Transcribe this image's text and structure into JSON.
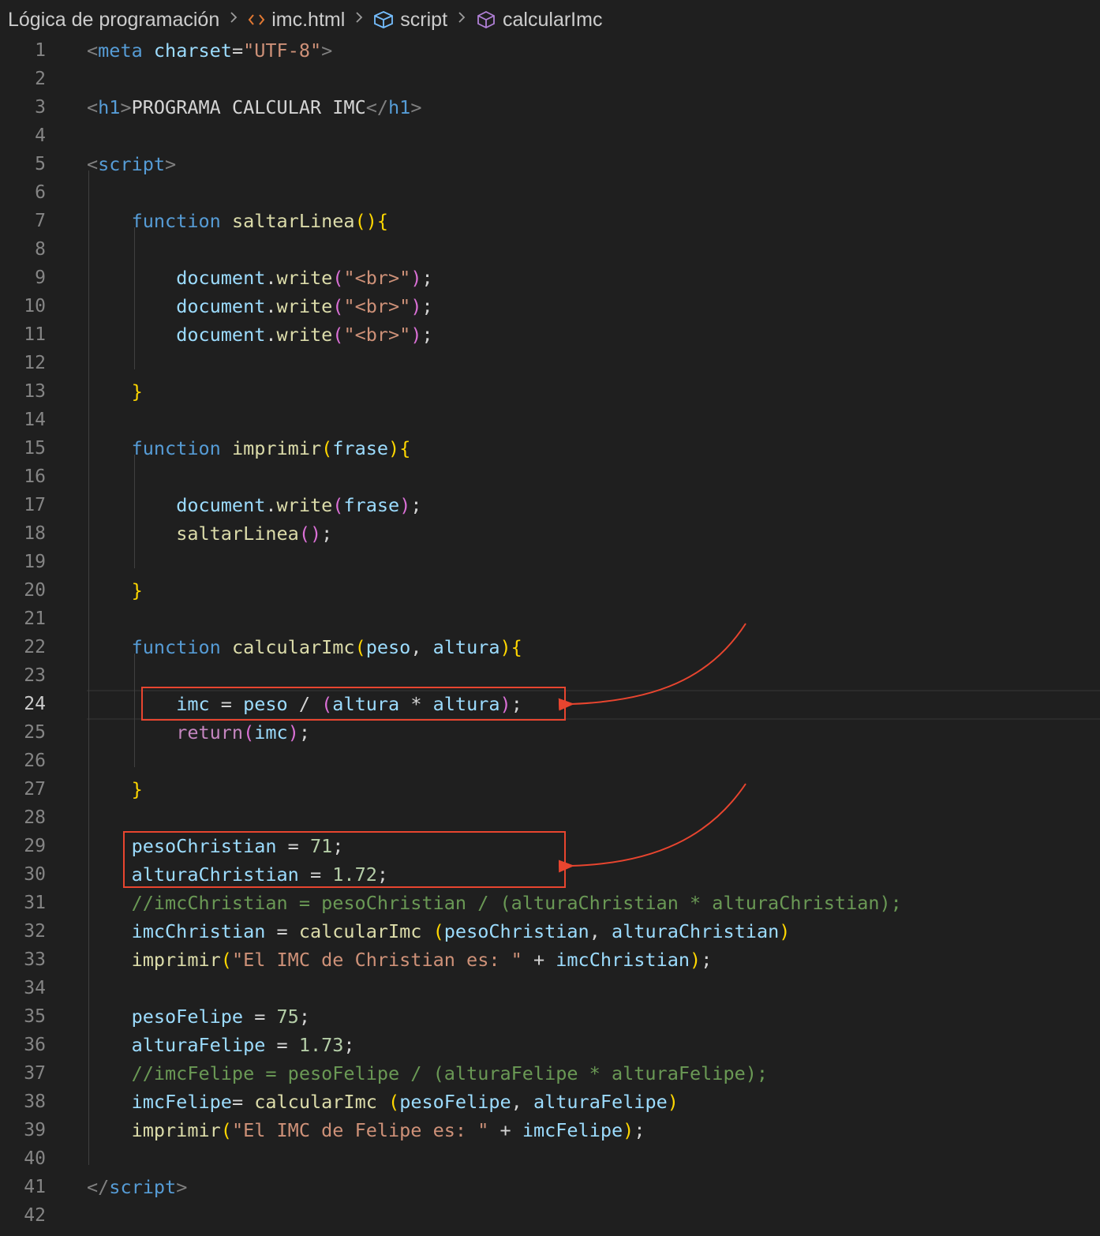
{
  "breadcrumb": {
    "items": [
      {
        "label": "Lógica de programación",
        "icon": null
      },
      {
        "label": "imc.html",
        "icon": "html-code-icon"
      },
      {
        "label": "script",
        "icon": "cube-icon"
      },
      {
        "label": "calcularImc",
        "icon": "method-cube-icon"
      }
    ]
  },
  "editor": {
    "active_line": 24,
    "lines": [
      {
        "n": "1",
        "tokens": [
          [
            "<",
            "punct"
          ],
          [
            "meta",
            "tag"
          ],
          [
            " ",
            "txt"
          ],
          [
            "charset",
            "attr"
          ],
          [
            "=",
            "txt"
          ],
          [
            "\"UTF-8\"",
            "str"
          ],
          [
            ">",
            "punct"
          ]
        ]
      },
      {
        "n": "2",
        "tokens": []
      },
      {
        "n": "3",
        "tokens": [
          [
            "<",
            "punct"
          ],
          [
            "h1",
            "tag"
          ],
          [
            ">",
            "punct"
          ],
          [
            "PROGRAMA CALCULAR IMC",
            "txt"
          ],
          [
            "</",
            "punct"
          ],
          [
            "h1",
            "tag"
          ],
          [
            ">",
            "punct"
          ]
        ]
      },
      {
        "n": "4",
        "tokens": []
      },
      {
        "n": "5",
        "tokens": [
          [
            "<",
            "punct"
          ],
          [
            "script",
            "tag"
          ],
          [
            ">",
            "punct"
          ]
        ]
      },
      {
        "n": "6",
        "tokens": []
      },
      {
        "n": "7",
        "tokens": [
          [
            "    ",
            "txt"
          ],
          [
            "function",
            "kw"
          ],
          [
            " ",
            "txt"
          ],
          [
            "saltarLinea",
            "fn"
          ],
          [
            "()",
            "b1"
          ],
          [
            "{",
            "b1"
          ]
        ]
      },
      {
        "n": "8",
        "tokens": []
      },
      {
        "n": "9",
        "tokens": [
          [
            "        ",
            "txt"
          ],
          [
            "document",
            "var"
          ],
          [
            ".",
            "txt"
          ],
          [
            "write",
            "fn"
          ],
          [
            "(",
            "b2"
          ],
          [
            "\"<br>\"",
            "str"
          ],
          [
            ")",
            "b2"
          ],
          [
            ";",
            "txt"
          ]
        ]
      },
      {
        "n": "10",
        "tokens": [
          [
            "        ",
            "txt"
          ],
          [
            "document",
            "var"
          ],
          [
            ".",
            "txt"
          ],
          [
            "write",
            "fn"
          ],
          [
            "(",
            "b2"
          ],
          [
            "\"<br>\"",
            "str"
          ],
          [
            ")",
            "b2"
          ],
          [
            ";",
            "txt"
          ]
        ]
      },
      {
        "n": "11",
        "tokens": [
          [
            "        ",
            "txt"
          ],
          [
            "document",
            "var"
          ],
          [
            ".",
            "txt"
          ],
          [
            "write",
            "fn"
          ],
          [
            "(",
            "b2"
          ],
          [
            "\"<br>\"",
            "str"
          ],
          [
            ")",
            "b2"
          ],
          [
            ";",
            "txt"
          ]
        ]
      },
      {
        "n": "12",
        "tokens": []
      },
      {
        "n": "13",
        "tokens": [
          [
            "    ",
            "txt"
          ],
          [
            "}",
            "b1"
          ]
        ]
      },
      {
        "n": "14",
        "tokens": []
      },
      {
        "n": "15",
        "tokens": [
          [
            "    ",
            "txt"
          ],
          [
            "function",
            "kw"
          ],
          [
            " ",
            "txt"
          ],
          [
            "imprimir",
            "fn"
          ],
          [
            "(",
            "b1"
          ],
          [
            "frase",
            "var"
          ],
          [
            ")",
            "b1"
          ],
          [
            "{",
            "b1"
          ]
        ]
      },
      {
        "n": "16",
        "tokens": []
      },
      {
        "n": "17",
        "tokens": [
          [
            "        ",
            "txt"
          ],
          [
            "document",
            "var"
          ],
          [
            ".",
            "txt"
          ],
          [
            "write",
            "fn"
          ],
          [
            "(",
            "b2"
          ],
          [
            "frase",
            "var"
          ],
          [
            ")",
            "b2"
          ],
          [
            ";",
            "txt"
          ]
        ]
      },
      {
        "n": "18",
        "tokens": [
          [
            "        ",
            "txt"
          ],
          [
            "saltarLinea",
            "fn"
          ],
          [
            "()",
            "b2"
          ],
          [
            ";",
            "txt"
          ]
        ]
      },
      {
        "n": "19",
        "tokens": []
      },
      {
        "n": "20",
        "tokens": [
          [
            "    ",
            "txt"
          ],
          [
            "}",
            "b1"
          ]
        ]
      },
      {
        "n": "21",
        "tokens": []
      },
      {
        "n": "22",
        "tokens": [
          [
            "    ",
            "txt"
          ],
          [
            "function",
            "kw"
          ],
          [
            " ",
            "txt"
          ],
          [
            "calcularImc",
            "fn"
          ],
          [
            "(",
            "b1"
          ],
          [
            "peso",
            "var"
          ],
          [
            ", ",
            "txt"
          ],
          [
            "altura",
            "var"
          ],
          [
            ")",
            "b1"
          ],
          [
            "{",
            "b1"
          ]
        ]
      },
      {
        "n": "23",
        "tokens": []
      },
      {
        "n": "24",
        "tokens": [
          [
            "        ",
            "txt"
          ],
          [
            "imc",
            "var"
          ],
          [
            " = ",
            "txt"
          ],
          [
            "peso",
            "var"
          ],
          [
            " / ",
            "txt"
          ],
          [
            "(",
            "b2"
          ],
          [
            "altura",
            "var"
          ],
          [
            " * ",
            "txt"
          ],
          [
            "altura",
            "var"
          ],
          [
            ")",
            "b2"
          ],
          [
            ";",
            "txt"
          ]
        ]
      },
      {
        "n": "25",
        "tokens": [
          [
            "        ",
            "txt"
          ],
          [
            "return",
            "ctl"
          ],
          [
            "(",
            "b2"
          ],
          [
            "imc",
            "var"
          ],
          [
            ")",
            "b2"
          ],
          [
            ";",
            "txt"
          ]
        ]
      },
      {
        "n": "26",
        "tokens": []
      },
      {
        "n": "27",
        "tokens": [
          [
            "    ",
            "txt"
          ],
          [
            "}",
            "b1"
          ]
        ]
      },
      {
        "n": "28",
        "tokens": []
      },
      {
        "n": "29",
        "tokens": [
          [
            "    ",
            "txt"
          ],
          [
            "pesoChristian",
            "var"
          ],
          [
            " = ",
            "txt"
          ],
          [
            "71",
            "num"
          ],
          [
            ";",
            "txt"
          ]
        ]
      },
      {
        "n": "30",
        "tokens": [
          [
            "    ",
            "txt"
          ],
          [
            "alturaChristian",
            "var"
          ],
          [
            " = ",
            "txt"
          ],
          [
            "1.72",
            "num"
          ],
          [
            ";",
            "txt"
          ]
        ]
      },
      {
        "n": "31",
        "tokens": [
          [
            "    ",
            "txt"
          ],
          [
            "//imcChristian = pesoChristian / (alturaChristian * alturaChristian);",
            "cmt"
          ]
        ]
      },
      {
        "n": "32",
        "tokens": [
          [
            "    ",
            "txt"
          ],
          [
            "imcChristian",
            "var"
          ],
          [
            " = ",
            "txt"
          ],
          [
            "calcularImc",
            "fn"
          ],
          [
            " ",
            "txt"
          ],
          [
            "(",
            "b1"
          ],
          [
            "pesoChristian",
            "var"
          ],
          [
            ", ",
            "txt"
          ],
          [
            "alturaChristian",
            "var"
          ],
          [
            ")",
            "b1"
          ]
        ]
      },
      {
        "n": "33",
        "tokens": [
          [
            "    ",
            "txt"
          ],
          [
            "imprimir",
            "fn"
          ],
          [
            "(",
            "b1"
          ],
          [
            "\"El IMC de Christian es: \"",
            "str"
          ],
          [
            " + ",
            "txt"
          ],
          [
            "imcChristian",
            "var"
          ],
          [
            ")",
            "b1"
          ],
          [
            ";",
            "txt"
          ]
        ]
      },
      {
        "n": "34",
        "tokens": []
      },
      {
        "n": "35",
        "tokens": [
          [
            "    ",
            "txt"
          ],
          [
            "pesoFelipe",
            "var"
          ],
          [
            " = ",
            "txt"
          ],
          [
            "75",
            "num"
          ],
          [
            ";",
            "txt"
          ]
        ]
      },
      {
        "n": "36",
        "tokens": [
          [
            "    ",
            "txt"
          ],
          [
            "alturaFelipe",
            "var"
          ],
          [
            " = ",
            "txt"
          ],
          [
            "1.73",
            "num"
          ],
          [
            ";",
            "txt"
          ]
        ]
      },
      {
        "n": "37",
        "tokens": [
          [
            "    ",
            "txt"
          ],
          [
            "//imcFelipe = pesoFelipe / (alturaFelipe * alturaFelipe);",
            "cmt"
          ]
        ]
      },
      {
        "n": "38",
        "tokens": [
          [
            "    ",
            "txt"
          ],
          [
            "imcFelipe",
            "var"
          ],
          [
            "= ",
            "txt"
          ],
          [
            "calcularImc",
            "fn"
          ],
          [
            " ",
            "txt"
          ],
          [
            "(",
            "b1"
          ],
          [
            "pesoFelipe",
            "var"
          ],
          [
            ", ",
            "txt"
          ],
          [
            "alturaFelipe",
            "var"
          ],
          [
            ")",
            "b1"
          ]
        ]
      },
      {
        "n": "39",
        "tokens": [
          [
            "    ",
            "txt"
          ],
          [
            "imprimir",
            "fn"
          ],
          [
            "(",
            "b1"
          ],
          [
            "\"El IMC de Felipe es: \"",
            "str"
          ],
          [
            " + ",
            "txt"
          ],
          [
            "imcFelipe",
            "var"
          ],
          [
            ")",
            "b1"
          ],
          [
            ";",
            "txt"
          ]
        ]
      },
      {
        "n": "40",
        "tokens": []
      },
      {
        "n": "41",
        "tokens": [
          [
            "</",
            "punct"
          ],
          [
            "script",
            "tag"
          ],
          [
            ">",
            "punct"
          ]
        ]
      },
      {
        "n": "42",
        "tokens": []
      }
    ]
  },
  "annotations": {
    "color": "#e8452f",
    "highlight_lines": [
      [
        24
      ],
      [
        29,
        30
      ]
    ]
  },
  "colors": {
    "background": "#1f1f1f",
    "line_number": "#858585",
    "line_number_active": "#cccccc",
    "annotation": "#e8452f"
  }
}
